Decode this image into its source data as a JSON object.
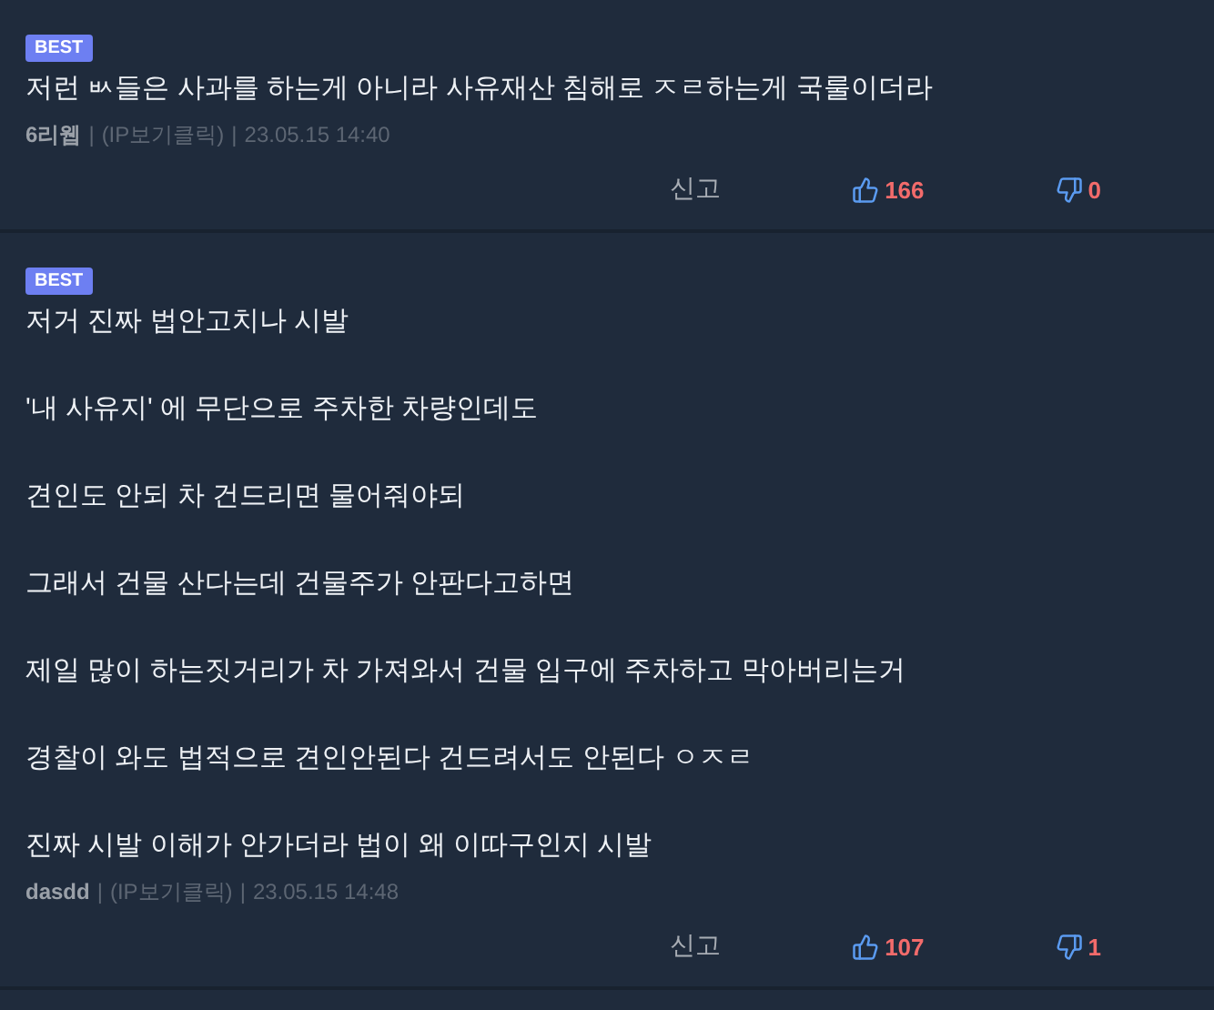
{
  "comments": [
    {
      "badge": "BEST",
      "body": [
        "저런 ㅄ들은 사과를 하는게 아니라 사유재산 침해로 ㅈㄹ하는게 국룰이더라"
      ],
      "meta": [
        {
          "kind": "author",
          "text": "6리웹"
        },
        {
          "kind": "separator",
          "text": "|"
        },
        {
          "kind": "ip",
          "text": "(IP보기클릭)"
        },
        {
          "kind": "separator",
          "text": "|"
        },
        {
          "kind": "date",
          "text": "23.05.15 14:40"
        }
      ],
      "report": "신고",
      "likes": "166",
      "dislikes": "0"
    },
    {
      "badge": "BEST",
      "body": [
        "저거 진짜 법안고치나 시발",
        "'내 사유지' 에 무단으로 주차한 차량인데도",
        "견인도 안되 차 건드리면 물어줘야되",
        "그래서 건물 산다는데 건물주가 안판다고하면",
        "제일 많이 하는짓거리가 차 가져와서 건물 입구에 주차하고 막아버리는거",
        "경찰이 와도 법적으로 견인안된다 건드려서도 안된다 ㅇㅈㄹ",
        "진짜 시발 이해가 안가더라 법이 왜 이따구인지 시발"
      ],
      "meta": [
        {
          "kind": "author",
          "text": "dasdd"
        },
        {
          "kind": "separator",
          "text": "|"
        },
        {
          "kind": "ip",
          "text": "(IP보기클릭)"
        },
        {
          "kind": "separator",
          "text": "|"
        },
        {
          "kind": "date",
          "text": "23.05.15 14:48"
        }
      ],
      "report": "신고",
      "likes": "107",
      "dislikes": "1"
    }
  ]
}
